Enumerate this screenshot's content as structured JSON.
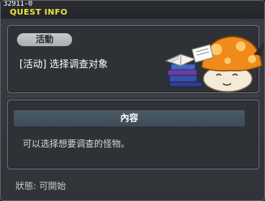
{
  "window": {
    "quest_id": "32911-0",
    "title": "QUEST INFO"
  },
  "quest": {
    "type_tag": "活動",
    "name": "[活动] 选择调查对象"
  },
  "content": {
    "header": "內容",
    "text": "可以选择想要调查的怪物。"
  },
  "status": {
    "text": "狀態: 可開始"
  },
  "colors": {
    "title_text": "#f0e23a",
    "panel_bg": "#2e3136",
    "content_header_bg": "#46555f"
  },
  "icons": {
    "illustration": "mushroom-reading-books-icon"
  }
}
